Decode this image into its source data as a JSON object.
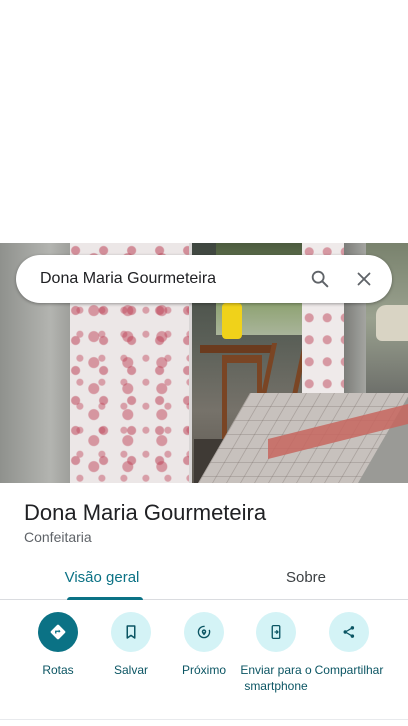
{
  "search": {
    "query": "Dona Maria Gourmeteira",
    "search_icon": "search-icon",
    "close_icon": "close-icon"
  },
  "photo": {
    "description_icon": "place-photo"
  },
  "place": {
    "name": "Dona Maria Gourmeteira",
    "category": "Confeitaria"
  },
  "tabs": [
    {
      "label": "Visão geral",
      "active": true
    },
    {
      "label": "Sobre",
      "active": false
    }
  ],
  "actions": [
    {
      "label": "Rotas",
      "icon": "directions-icon"
    },
    {
      "label": "Salvar",
      "icon": "bookmark-icon"
    },
    {
      "label": "Próximo",
      "icon": "nearby-icon"
    },
    {
      "label": "Enviar para o smartphone",
      "icon": "send-to-phone-icon"
    },
    {
      "label": "Compartilhar",
      "icon": "share-icon"
    }
  ],
  "colors": {
    "accent": "#0b7285",
    "action_circle": "#d4f3f6",
    "text_primary": "#202124",
    "text_secondary": "#5f6368"
  }
}
